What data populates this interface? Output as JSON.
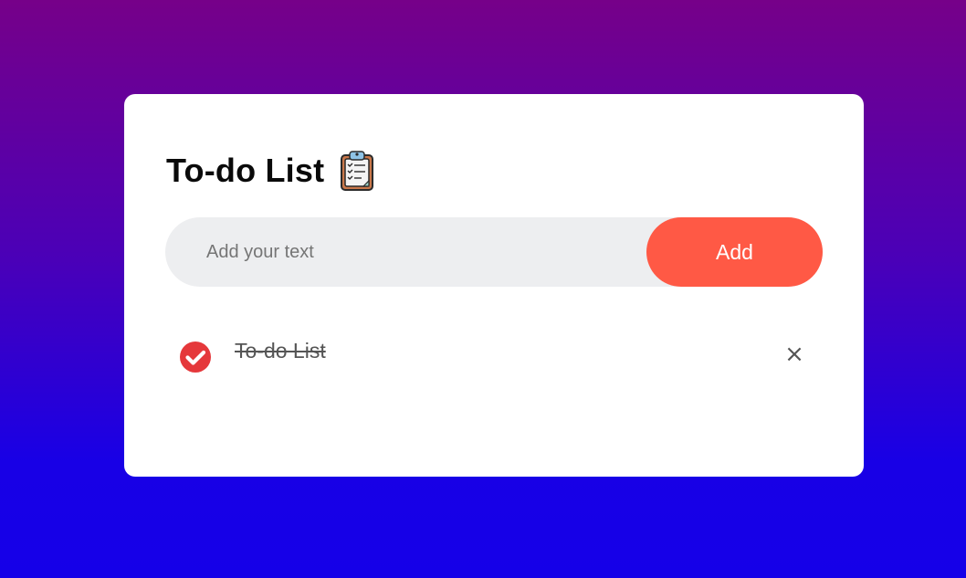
{
  "app": {
    "title": "To-do List",
    "title_icon": "clipboard-icon"
  },
  "input": {
    "value": "",
    "placeholder": "Add your text"
  },
  "add_button": {
    "label": "Add"
  },
  "colors": {
    "accent": "#ff5945",
    "check": "#e5383b",
    "input_bg": "#edeef0",
    "background_top": "#760089",
    "background_bottom": "#1500e8"
  },
  "tasks": [
    {
      "text": "To-do List",
      "checked": true,
      "check_icon": "checked-circle-icon",
      "remove_symbol": "×",
      "remove_icon": "close-icon"
    }
  ]
}
